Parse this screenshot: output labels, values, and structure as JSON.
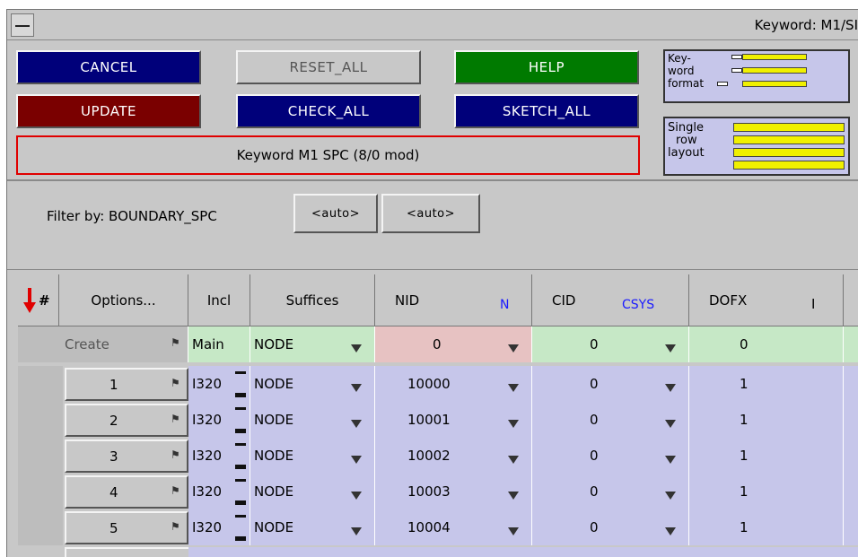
{
  "window": {
    "title": "Keyword: M1/SI"
  },
  "buttons": {
    "cancel": "CANCEL",
    "reset_all": "RESET_ALL",
    "help": "HELP",
    "update": "UPDATE",
    "check_all": "CHECK_ALL",
    "sketch_all": "SKETCH_ALL"
  },
  "keyword_title": "Keyword M1 SPC (8/0 mod)",
  "format_box": {
    "line1": "Key-",
    "line2": "word",
    "line3": "format"
  },
  "layout_box": {
    "line1": "Single",
    "line2": "row",
    "line3": "layout"
  },
  "filter": {
    "label": "Filter by: BOUNDARY_SPC",
    "auto1": "<auto>",
    "auto2": "<auto>"
  },
  "table": {
    "headers": {
      "num": "#",
      "options": "Options...",
      "incl": "Incl",
      "suffices": "Suffices",
      "nid": "NID",
      "nid_tag": "N",
      "cid": "CID",
      "cid_tag": "CSYS",
      "dofx": "DOFX",
      "dofx_tag": "I"
    },
    "create_row": {
      "label": "Create",
      "incl": "Main",
      "suffix": "NODE",
      "nid": "0",
      "cid": "0",
      "dofx": "0"
    },
    "rows": [
      {
        "num": "1",
        "incl": "I320",
        "suffix": "NODE",
        "nid": "10000",
        "cid": "0",
        "dofx": "1"
      },
      {
        "num": "2",
        "incl": "I320",
        "suffix": "NODE",
        "nid": "10001",
        "cid": "0",
        "dofx": "1"
      },
      {
        "num": "3",
        "incl": "I320",
        "suffix": "NODE",
        "nid": "10002",
        "cid": "0",
        "dofx": "1"
      },
      {
        "num": "4",
        "incl": "I320",
        "suffix": "NODE",
        "nid": "10003",
        "cid": "0",
        "dofx": "1"
      },
      {
        "num": "5",
        "incl": "I320",
        "suffix": "NODE",
        "nid": "10004",
        "cid": "0",
        "dofx": "1"
      }
    ]
  },
  "colors": {
    "navy": "#00007a",
    "maroon": "#7a0000",
    "green": "#007a00",
    "pink_cell": "#e7c2c2",
    "green_cell": "#c6e8c6",
    "blue_cell": "#c6c6ea"
  },
  "icons": {
    "sort": "red-down-arrow-icon",
    "row_flag": "flag-icon",
    "dropdown": "dropdown-triangle-icon"
  }
}
